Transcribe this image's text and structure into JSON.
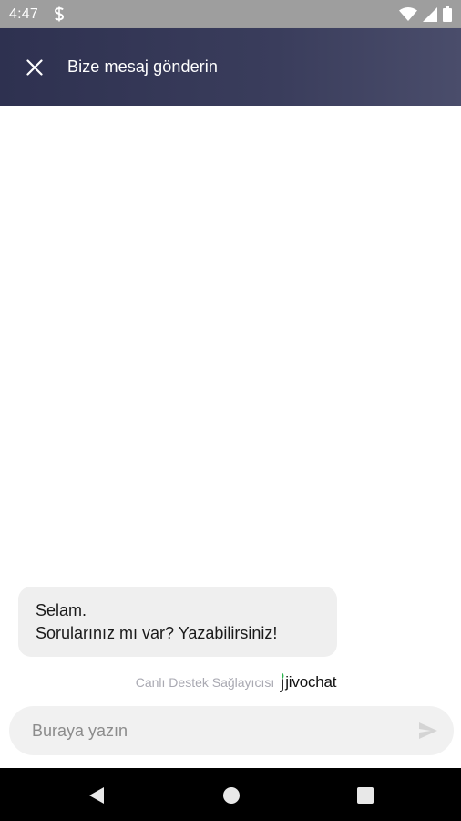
{
  "status_bar": {
    "time": "4:47",
    "icons": [
      "app-notification-icon",
      "wifi-icon",
      "cellular-signal-icon",
      "battery-icon"
    ]
  },
  "header": {
    "title": "Bize mesaj gönderin",
    "close_icon": "close-icon",
    "gradient": [
      "#2e3150",
      "#4a4d6b"
    ]
  },
  "messages": [
    {
      "lines": [
        "Selam.",
        "Sorularınız mı var? Yazabilirsiniz!"
      ]
    }
  ],
  "provider": {
    "label": "Canlı Destek Sağlayıcısı",
    "logo_text": "jivochat",
    "logo_accent": "#2bb24c"
  },
  "composer": {
    "placeholder": "Buraya yazın",
    "value": "",
    "send_icon": "send-icon"
  },
  "nav_bar": {
    "buttons": [
      "back-icon",
      "home-icon",
      "recents-icon"
    ]
  }
}
